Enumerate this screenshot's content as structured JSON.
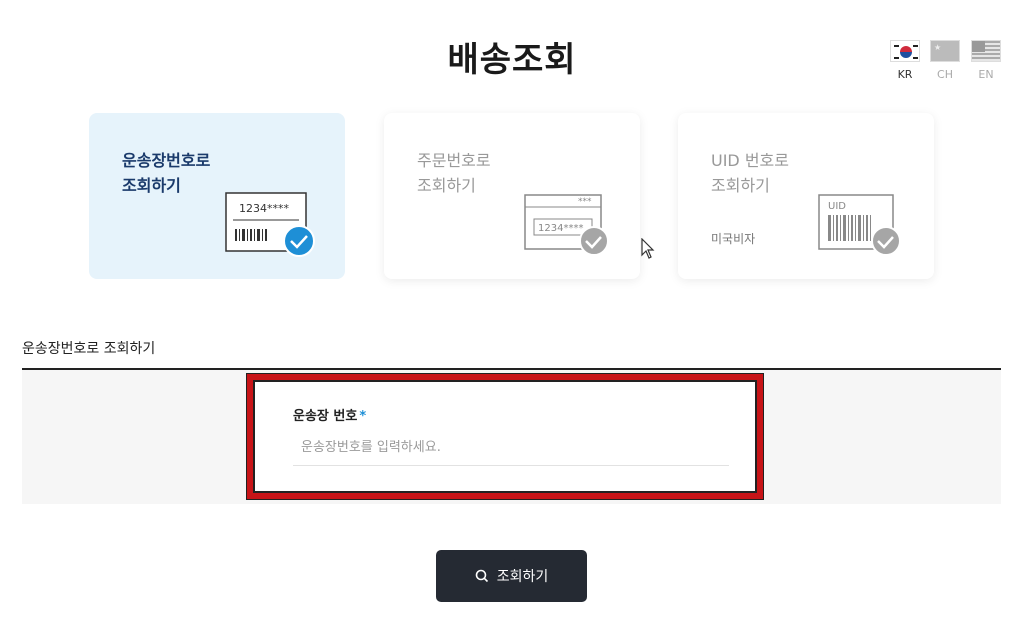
{
  "header": {
    "title": "배송조회"
  },
  "languages": [
    {
      "code": "KR",
      "active": true
    },
    {
      "code": "CH",
      "active": false
    },
    {
      "code": "EN",
      "active": false
    }
  ],
  "lookup_options": [
    {
      "title": "운송장번호로\n조회하기",
      "illustration_text": "1234****",
      "active": true,
      "icon": "check-circle-icon"
    },
    {
      "title": "주문번호로\n조회하기",
      "illustration_text": "1234****",
      "illustration_dots": "***",
      "active": false,
      "icon": "check-circle-icon"
    },
    {
      "title": "UID 번호로\n조회하기",
      "subtitle": "미국비자",
      "illustration_text": "UID",
      "active": false,
      "icon": "check-circle-icon"
    }
  ],
  "section": {
    "label": "운송장번호로 조회하기"
  },
  "form": {
    "field_label": "운송장 번호",
    "required_mark": "*",
    "placeholder": "운송장번호를 입력하세요.",
    "value": ""
  },
  "search_button": {
    "label": "조회하기",
    "icon": "search-icon"
  },
  "colors": {
    "accent": "#1e8fd6",
    "highlight": "#c81418",
    "button": "#252a33",
    "active_card": "#e6f3fb"
  }
}
